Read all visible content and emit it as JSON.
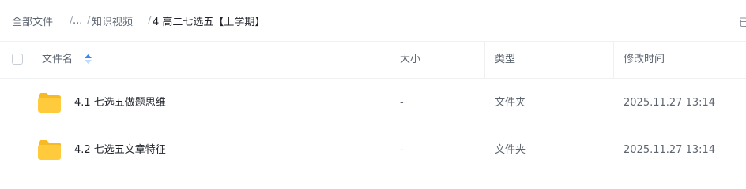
{
  "breadcrumb": {
    "items": [
      "全部文件",
      "...",
      "知识视频",
      "4 高二七选五【上学期】"
    ],
    "separator": "/",
    "right_fragment": "已"
  },
  "table": {
    "columns": {
      "name": "文件名",
      "size": "大小",
      "type": "类型",
      "modified": "修改时间"
    },
    "sort": {
      "column": "name",
      "direction": "ascending"
    },
    "rows": [
      {
        "name": "4.1 七选五做题思维",
        "size": "-",
        "type": "文件夹",
        "modified": "2025.11.27 13:14",
        "icon": "folder-icon"
      },
      {
        "name": "4.2 七选五文章特征",
        "size": "-",
        "type": "文件夹",
        "modified": "2025.11.27 13:14",
        "icon": "folder-icon"
      }
    ]
  },
  "colors": {
    "folder": "#FFCB3D",
    "folder_tab": "#F7B924",
    "sort_active": "#3B82F6",
    "divider": "#EEF0F2"
  }
}
